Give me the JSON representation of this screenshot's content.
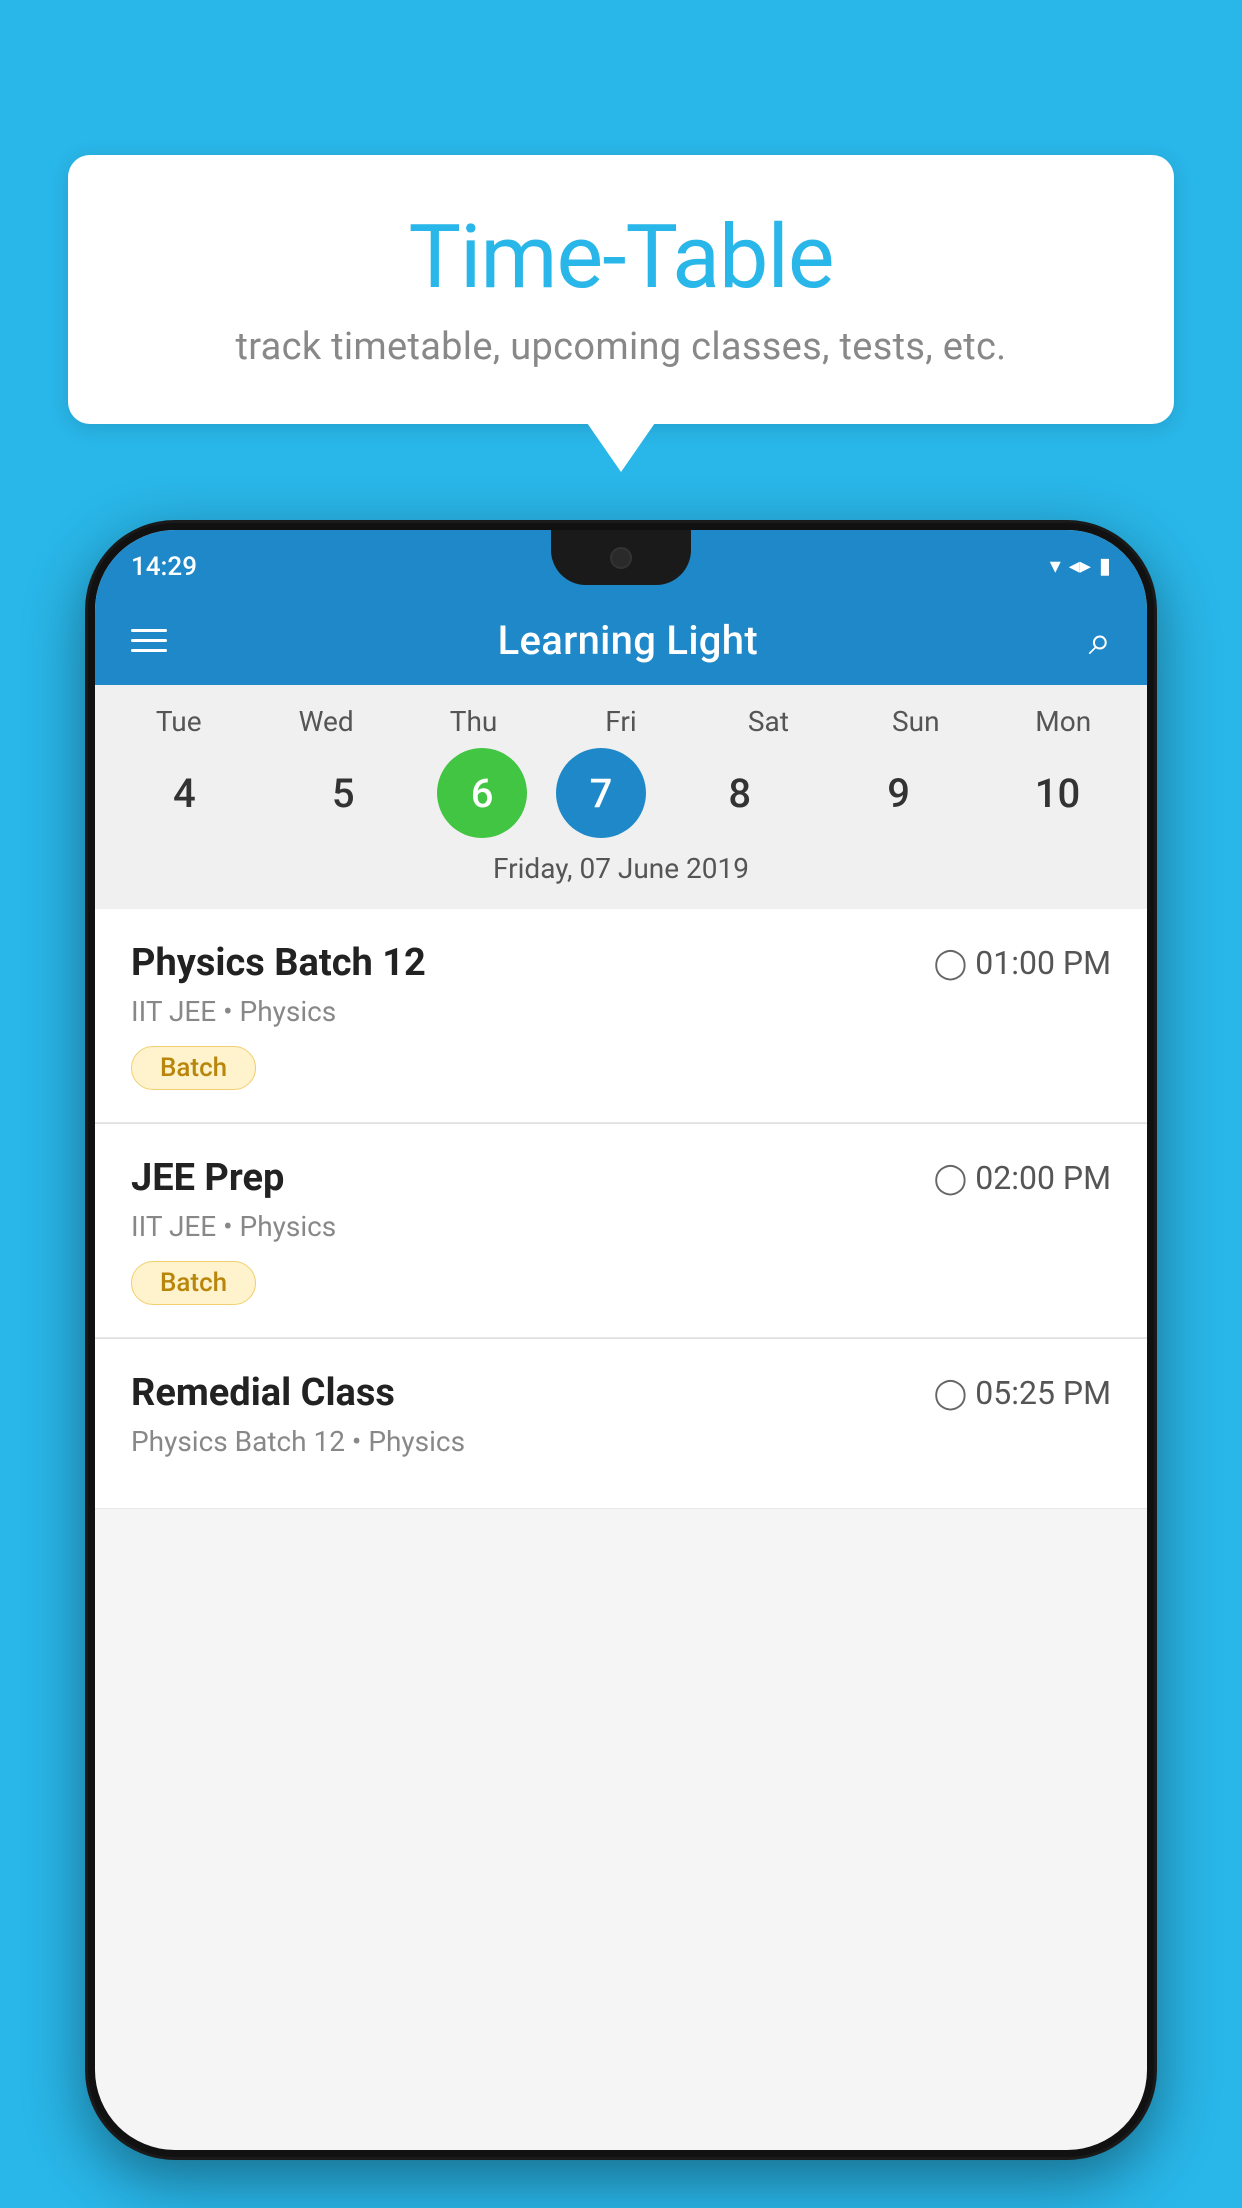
{
  "page": {
    "background_color": "#29b6e8"
  },
  "speech_bubble": {
    "title": "Time-Table",
    "subtitle": "track timetable, upcoming classes, tests, etc."
  },
  "phone": {
    "status_bar": {
      "time": "14:29"
    },
    "app_header": {
      "title": "Learning Light",
      "menu_icon": "hamburger-menu",
      "search_icon": "search"
    },
    "calendar": {
      "days": [
        {
          "label": "Tue",
          "number": "4"
        },
        {
          "label": "Wed",
          "number": "5"
        },
        {
          "label": "Thu",
          "number": "6",
          "state": "today"
        },
        {
          "label": "Fri",
          "number": "7",
          "state": "selected"
        },
        {
          "label": "Sat",
          "number": "8"
        },
        {
          "label": "Sun",
          "number": "9"
        },
        {
          "label": "Mon",
          "number": "10"
        }
      ],
      "selected_date": "Friday, 07 June 2019"
    },
    "schedule": [
      {
        "class_name": "Physics Batch 12",
        "time": "01:00 PM",
        "details": "IIT JEE • Physics",
        "tag": "Batch"
      },
      {
        "class_name": "JEE Prep",
        "time": "02:00 PM",
        "details": "IIT JEE • Physics",
        "tag": "Batch"
      },
      {
        "class_name": "Remedial Class",
        "time": "05:25 PM",
        "details": "Physics Batch 12 • Physics",
        "tag": ""
      }
    ]
  }
}
